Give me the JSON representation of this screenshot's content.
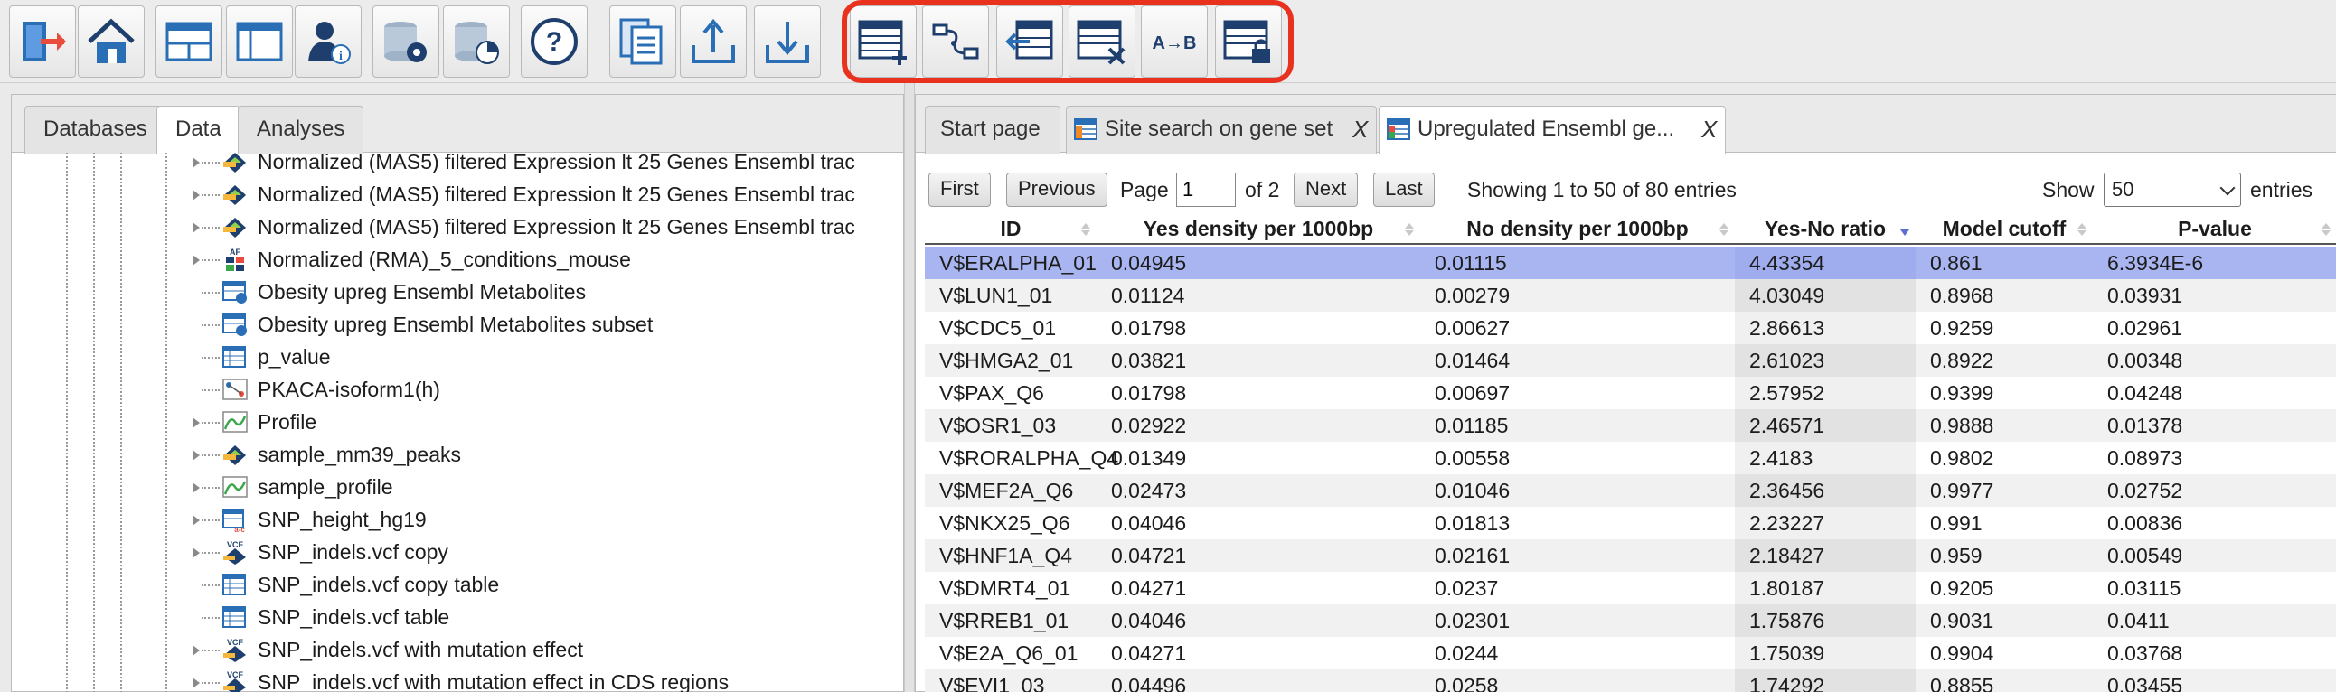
{
  "toolbar": {
    "buttons": [
      {
        "name": "exit-button",
        "icon": "exit-door-icon"
      },
      {
        "name": "home-button",
        "icon": "home-icon"
      },
      {
        "name": "layout-split-button",
        "icon": "layout-split-icon"
      },
      {
        "name": "layout-single-button",
        "icon": "layout-panel-icon"
      },
      {
        "name": "user-info-button",
        "icon": "user-info-icon"
      },
      {
        "name": "database-settings-button",
        "icon": "database-gear-icon"
      },
      {
        "name": "database-chart-button",
        "icon": "database-chart-icon"
      },
      {
        "name": "help-button",
        "icon": "help-icon"
      },
      {
        "name": "copy-document-button",
        "icon": "copy-document-icon"
      },
      {
        "name": "upload-button",
        "icon": "upload-icon"
      },
      {
        "name": "download-button",
        "icon": "download-icon"
      },
      {
        "name": "add-table-row-button",
        "icon": "table-add-icon"
      },
      {
        "name": "workflow-button",
        "icon": "workflow-icon"
      },
      {
        "name": "table-export-button",
        "icon": "table-export-icon"
      },
      {
        "name": "table-delete-button",
        "icon": "table-delete-icon"
      },
      {
        "name": "convert-a-to-b-button",
        "icon": "a-to-b-icon",
        "label": "A→B"
      },
      {
        "name": "table-lock-button",
        "icon": "table-lock-icon"
      }
    ]
  },
  "left_tabs": [
    "Databases",
    "Data",
    "Analyses"
  ],
  "tree": {
    "items": [
      {
        "label": "Normalized (MAS5) filtered Expression lt 25 Genes Ensembl trac",
        "icon": "track-arrow-icon"
      },
      {
        "label": "Normalized (MAS5) filtered Expression lt 25 Genes Ensembl trac",
        "icon": "track-arrow-icon"
      },
      {
        "label": "Normalized (MAS5) filtered Expression lt 25 Genes Ensembl trac",
        "icon": "track-arrow-icon"
      },
      {
        "label": "Normalized (RMA)_5_conditions_mouse",
        "icon": "affy-chip-icon"
      },
      {
        "label": "Obesity upreg Ensembl Metabolites",
        "icon": "table-blue-dot-icon"
      },
      {
        "label": "Obesity upreg Ensembl Metabolites subset",
        "icon": "table-blue-dot-icon"
      },
      {
        "label": "p_value",
        "icon": "table-icon"
      },
      {
        "label": "PKACA-isoform1(h)",
        "icon": "network-diagram-icon"
      },
      {
        "label": "Profile",
        "icon": "profile-chart-icon"
      },
      {
        "label": "sample_mm39_peaks",
        "icon": "track-arrow-icon"
      },
      {
        "label": "sample_profile",
        "icon": "profile-chart-icon"
      },
      {
        "label": "SNP_height_hg19",
        "icon": "table-snp-icon"
      },
      {
        "label": "SNP_indels.vcf copy",
        "icon": "vcf-track-icon"
      },
      {
        "label": "SNP_indels.vcf copy table",
        "icon": "table-icon"
      },
      {
        "label": "SNP_indels.vcf table",
        "icon": "table-icon"
      },
      {
        "label": "SNP_indels.vcf with mutation effect",
        "icon": "vcf-track-icon"
      },
      {
        "label": "SNP_indels.vcf with mutation effect in CDS regions",
        "icon": "vcf-track-icon"
      }
    ]
  },
  "doc_tabs": [
    {
      "label": "Start page",
      "icon": "",
      "closable": false
    },
    {
      "label": "Site search on gene set",
      "icon": "table-orange-icon",
      "closable": true
    },
    {
      "label": "Upregulated Ensembl ge...",
      "icon": "table-green-icon",
      "closable": true
    }
  ],
  "close_glyph": "X",
  "paging": {
    "first": "First",
    "previous": "Previous",
    "page_label": "Page",
    "page_value": "1",
    "of_text": "of 2",
    "next": "Next",
    "last": "Last",
    "info": "Showing 1 to 50 of 80 entries",
    "show_label": "Show",
    "show_value": "50",
    "entries_label": "entries"
  },
  "table": {
    "columns": [
      "ID",
      "Yes density per 1000bp",
      "No density per 1000bp",
      "Yes-No ratio",
      "Model cutoff",
      "P-value"
    ],
    "sorted_column": "Yes-No ratio",
    "sort_direction": "descending",
    "selected_row": 0,
    "rows": [
      [
        "V$ERALPHA_01",
        "0.04945",
        "0.01115",
        "4.43354",
        "0.861",
        "6.3934E-6"
      ],
      [
        "V$LUN1_01",
        "0.01124",
        "0.00279",
        "4.03049",
        "0.8968",
        "0.03931"
      ],
      [
        "V$CDC5_01",
        "0.01798",
        "0.00627",
        "2.86613",
        "0.9259",
        "0.02961"
      ],
      [
        "V$HMGA2_01",
        "0.03821",
        "0.01464",
        "2.61023",
        "0.8922",
        "0.00348"
      ],
      [
        "V$PAX_Q6",
        "0.01798",
        "0.00697",
        "2.57952",
        "0.9399",
        "0.04248"
      ],
      [
        "V$OSR1_03",
        "0.02922",
        "0.01185",
        "2.46571",
        "0.9888",
        "0.01378"
      ],
      [
        "V$RORALPHA_Q4",
        "0.01349",
        "0.00558",
        "2.4183",
        "0.9802",
        "0.08973"
      ],
      [
        "V$MEF2A_Q6",
        "0.02473",
        "0.01046",
        "2.36456",
        "0.9977",
        "0.02752"
      ],
      [
        "V$NKX25_Q6",
        "0.04046",
        "0.01813",
        "2.23227",
        "0.991",
        "0.00836"
      ],
      [
        "V$HNF1A_Q4",
        "0.04721",
        "0.02161",
        "2.18427",
        "0.959",
        "0.00549"
      ],
      [
        "V$DMRT4_01",
        "0.04271",
        "0.0237",
        "1.80187",
        "0.9205",
        "0.03115"
      ],
      [
        "V$RREB1_01",
        "0.04046",
        "0.02301",
        "1.75876",
        "0.9031",
        "0.0411"
      ],
      [
        "V$E2A_Q6_01",
        "0.04271",
        "0.0244",
        "1.75039",
        "0.9904",
        "0.03768"
      ],
      [
        "V$EVI1_03",
        "0.04496",
        "0.0258",
        "1.74292",
        "0.8855",
        "0.03455"
      ]
    ]
  },
  "colors": {
    "highlight": "#e8321e",
    "selected_row": "#a8b5f0",
    "icon_blue": "#2a6fb5",
    "icon_dark": "#1e3f6e",
    "sort_arrow_active": "#5a6fd0"
  }
}
